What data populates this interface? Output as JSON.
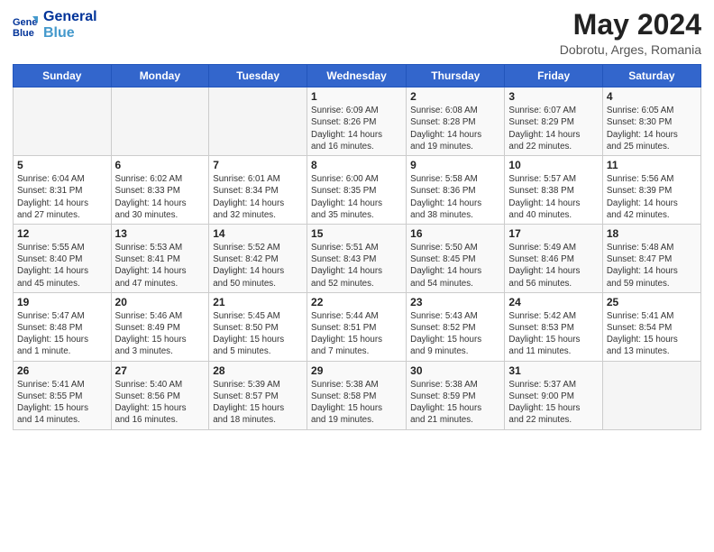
{
  "header": {
    "logo_line1": "General",
    "logo_line2": "Blue",
    "month": "May 2024",
    "location": "Dobrotu, Arges, Romania"
  },
  "weekdays": [
    "Sunday",
    "Monday",
    "Tuesday",
    "Wednesday",
    "Thursday",
    "Friday",
    "Saturday"
  ],
  "weeks": [
    [
      {
        "day": "",
        "info": ""
      },
      {
        "day": "",
        "info": ""
      },
      {
        "day": "",
        "info": ""
      },
      {
        "day": "1",
        "info": "Sunrise: 6:09 AM\nSunset: 8:26 PM\nDaylight: 14 hours\nand 16 minutes."
      },
      {
        "day": "2",
        "info": "Sunrise: 6:08 AM\nSunset: 8:28 PM\nDaylight: 14 hours\nand 19 minutes."
      },
      {
        "day": "3",
        "info": "Sunrise: 6:07 AM\nSunset: 8:29 PM\nDaylight: 14 hours\nand 22 minutes."
      },
      {
        "day": "4",
        "info": "Sunrise: 6:05 AM\nSunset: 8:30 PM\nDaylight: 14 hours\nand 25 minutes."
      }
    ],
    [
      {
        "day": "5",
        "info": "Sunrise: 6:04 AM\nSunset: 8:31 PM\nDaylight: 14 hours\nand 27 minutes."
      },
      {
        "day": "6",
        "info": "Sunrise: 6:02 AM\nSunset: 8:33 PM\nDaylight: 14 hours\nand 30 minutes."
      },
      {
        "day": "7",
        "info": "Sunrise: 6:01 AM\nSunset: 8:34 PM\nDaylight: 14 hours\nand 32 minutes."
      },
      {
        "day": "8",
        "info": "Sunrise: 6:00 AM\nSunset: 8:35 PM\nDaylight: 14 hours\nand 35 minutes."
      },
      {
        "day": "9",
        "info": "Sunrise: 5:58 AM\nSunset: 8:36 PM\nDaylight: 14 hours\nand 38 minutes."
      },
      {
        "day": "10",
        "info": "Sunrise: 5:57 AM\nSunset: 8:38 PM\nDaylight: 14 hours\nand 40 minutes."
      },
      {
        "day": "11",
        "info": "Sunrise: 5:56 AM\nSunset: 8:39 PM\nDaylight: 14 hours\nand 42 minutes."
      }
    ],
    [
      {
        "day": "12",
        "info": "Sunrise: 5:55 AM\nSunset: 8:40 PM\nDaylight: 14 hours\nand 45 minutes."
      },
      {
        "day": "13",
        "info": "Sunrise: 5:53 AM\nSunset: 8:41 PM\nDaylight: 14 hours\nand 47 minutes."
      },
      {
        "day": "14",
        "info": "Sunrise: 5:52 AM\nSunset: 8:42 PM\nDaylight: 14 hours\nand 50 minutes."
      },
      {
        "day": "15",
        "info": "Sunrise: 5:51 AM\nSunset: 8:43 PM\nDaylight: 14 hours\nand 52 minutes."
      },
      {
        "day": "16",
        "info": "Sunrise: 5:50 AM\nSunset: 8:45 PM\nDaylight: 14 hours\nand 54 minutes."
      },
      {
        "day": "17",
        "info": "Sunrise: 5:49 AM\nSunset: 8:46 PM\nDaylight: 14 hours\nand 56 minutes."
      },
      {
        "day": "18",
        "info": "Sunrise: 5:48 AM\nSunset: 8:47 PM\nDaylight: 14 hours\nand 59 minutes."
      }
    ],
    [
      {
        "day": "19",
        "info": "Sunrise: 5:47 AM\nSunset: 8:48 PM\nDaylight: 15 hours\nand 1 minute."
      },
      {
        "day": "20",
        "info": "Sunrise: 5:46 AM\nSunset: 8:49 PM\nDaylight: 15 hours\nand 3 minutes."
      },
      {
        "day": "21",
        "info": "Sunrise: 5:45 AM\nSunset: 8:50 PM\nDaylight: 15 hours\nand 5 minutes."
      },
      {
        "day": "22",
        "info": "Sunrise: 5:44 AM\nSunset: 8:51 PM\nDaylight: 15 hours\nand 7 minutes."
      },
      {
        "day": "23",
        "info": "Sunrise: 5:43 AM\nSunset: 8:52 PM\nDaylight: 15 hours\nand 9 minutes."
      },
      {
        "day": "24",
        "info": "Sunrise: 5:42 AM\nSunset: 8:53 PM\nDaylight: 15 hours\nand 11 minutes."
      },
      {
        "day": "25",
        "info": "Sunrise: 5:41 AM\nSunset: 8:54 PM\nDaylight: 15 hours\nand 13 minutes."
      }
    ],
    [
      {
        "day": "26",
        "info": "Sunrise: 5:41 AM\nSunset: 8:55 PM\nDaylight: 15 hours\nand 14 minutes."
      },
      {
        "day": "27",
        "info": "Sunrise: 5:40 AM\nSunset: 8:56 PM\nDaylight: 15 hours\nand 16 minutes."
      },
      {
        "day": "28",
        "info": "Sunrise: 5:39 AM\nSunset: 8:57 PM\nDaylight: 15 hours\nand 18 minutes."
      },
      {
        "day": "29",
        "info": "Sunrise: 5:38 AM\nSunset: 8:58 PM\nDaylight: 15 hours\nand 19 minutes."
      },
      {
        "day": "30",
        "info": "Sunrise: 5:38 AM\nSunset: 8:59 PM\nDaylight: 15 hours\nand 21 minutes."
      },
      {
        "day": "31",
        "info": "Sunrise: 5:37 AM\nSunset: 9:00 PM\nDaylight: 15 hours\nand 22 minutes."
      },
      {
        "day": "",
        "info": ""
      }
    ]
  ]
}
